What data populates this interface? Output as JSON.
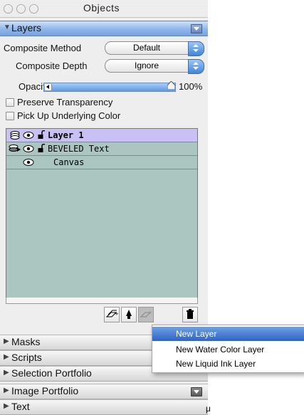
{
  "window": {
    "title": "Objects"
  },
  "sections": {
    "layers": "Layers",
    "masks": "Masks",
    "scripts": "Scripts",
    "selection_portfolio": "Selection Portfolio",
    "image_portfolio": "Image Portfolio",
    "text": "Text"
  },
  "layers_panel": {
    "composite_method_label": "Composite Method",
    "composite_method_value": "Default",
    "composite_depth_label": "Composite Depth",
    "composite_depth_value": "Ignore",
    "opacity_label": "Opacity",
    "opacity_value": "100%",
    "opacity_fraction": 1.0,
    "preserve_transparency_label": "Preserve Transparency",
    "pick_up_color_label": "Pick Up Underlying Color",
    "layers": [
      {
        "name": "Layer 1",
        "selected": true,
        "visible": true,
        "unlocked": true
      },
      {
        "name": "BEVELED Text",
        "selected": false,
        "visible": true,
        "unlocked": true
      },
      {
        "name": "Canvas",
        "selected": false,
        "visible": true,
        "unlocked": false
      }
    ]
  },
  "new_layer_menu": {
    "items": [
      "New Layer",
      "New Water Color Layer",
      "New Liquid Ink Layer"
    ],
    "highlighted_index": 0
  },
  "stray_text": "μ",
  "colors": {
    "active_section": "#8fb6ea",
    "layer_list_bg": "#abc5c0",
    "selected_layer": "#c9c0f4",
    "menu_highlight": "#2f63c4"
  },
  "icons": {
    "eye": "eye-icon",
    "lock_open": "unlocked-icon",
    "layer_stack": "layer-stack-icon",
    "new_layer": "new-layer-icon",
    "dynamic_plugin": "dynamic-plugin-icon",
    "layer_mask": "layer-mask-icon",
    "trash": "trash-icon"
  }
}
